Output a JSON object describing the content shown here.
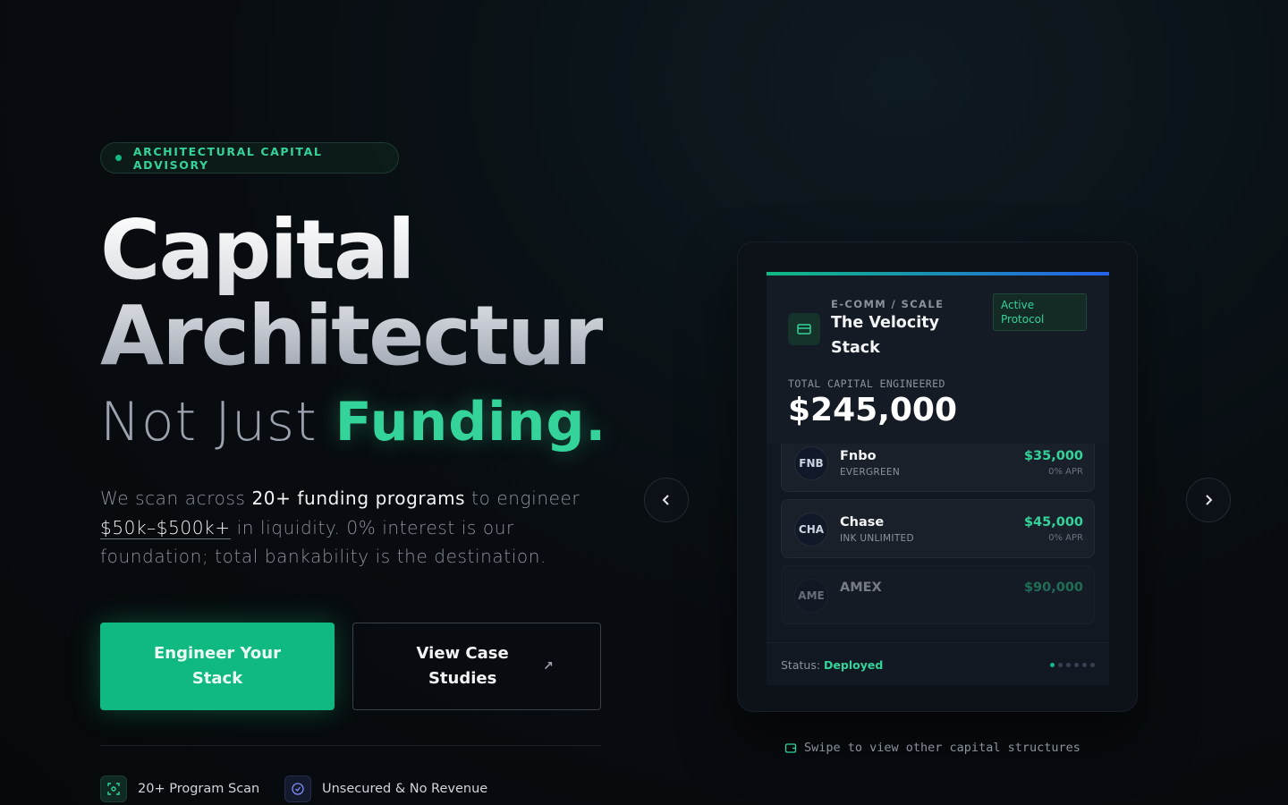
{
  "hero": {
    "badge": "ARCHITECTURAL CAPITAL ADVISORY",
    "title_line1": "Capital",
    "title_line2": "Architectur",
    "subtitle_plain": "Not Just",
    "subtitle_accent": "Funding.",
    "desc_1": "We scan across ",
    "desc_2": "20+ funding programs",
    "desc_3": " to engineer ",
    "desc_4": "$50k–$500k+",
    "desc_5": " in liquidity. 0% interest is our foundation; total bankability is the destination.",
    "primary_cta": "Engineer Your Stack",
    "secondary_cta": "View Case Studies",
    "features": [
      {
        "label": "20+ Program Scan",
        "icon": "scan-icon"
      },
      {
        "label": "Unsecured & No Revenue",
        "icon": "check-circle-icon"
      }
    ]
  },
  "card": {
    "category": "E-COMM / SCALE",
    "title": "The Velocity Stack",
    "status_pill": "Active Protocol",
    "total_label": "TOTAL CAPITAL ENGINEERED",
    "total_value": "$245,000",
    "items": [
      {
        "logo": "FNB",
        "name": "Fnbo",
        "sub": "EVERGREEN",
        "amount": "$35,000",
        "apr": "0% APR"
      },
      {
        "logo": "CHA",
        "name": "Chase",
        "sub": "INK UNLIMITED",
        "amount": "$45,000",
        "apr": "0% APR"
      },
      {
        "logo": "AME",
        "name": "AMEX",
        "sub": "",
        "amount": "$90,000",
        "apr": ""
      }
    ],
    "status_label": "Status:",
    "status_value": "Deployed",
    "pager_total": 6,
    "pager_active": 1
  },
  "swipe_hint": "Swipe to view other capital structures",
  "colors": {
    "accent": "#10b981",
    "accent_light": "#34d399",
    "blue": "#2563eb"
  }
}
